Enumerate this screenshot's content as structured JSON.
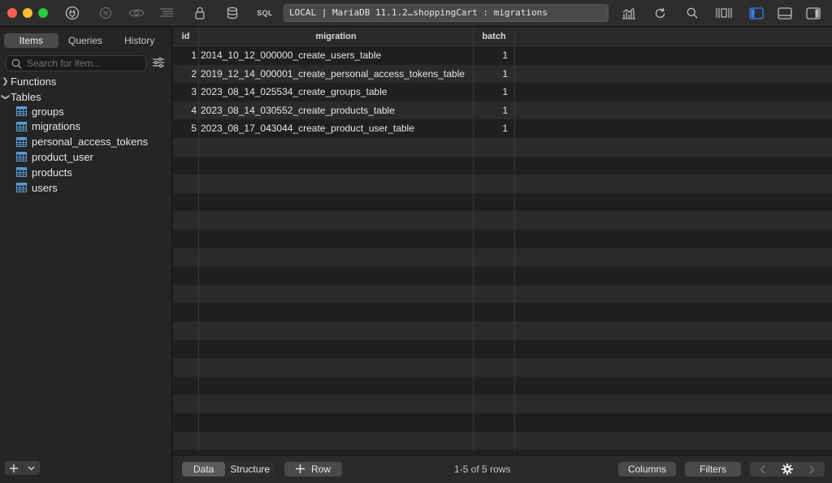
{
  "toolbar": {
    "sql_label": "SQL",
    "connection": "LOCAL | MariaDB 11.1.2…shoppingCart : migrations"
  },
  "sidebar": {
    "tabs": [
      {
        "label": "Items",
        "active": true
      },
      {
        "label": "Queries",
        "active": false
      },
      {
        "label": "History",
        "active": false
      }
    ],
    "search_placeholder": "Search for item...",
    "sections": {
      "functions": "Functions",
      "tables": "Tables"
    },
    "tables": [
      "groups",
      "migrations",
      "personal_access_tokens",
      "product_user",
      "products",
      "users"
    ]
  },
  "grid": {
    "columns": [
      "id",
      "migration",
      "batch"
    ],
    "rows": [
      {
        "id": "1",
        "migration": "2014_10_12_000000_create_users_table",
        "batch": "1"
      },
      {
        "id": "2",
        "migration": "2019_12_14_000001_create_personal_access_tokens_table",
        "batch": "1"
      },
      {
        "id": "3",
        "migration": "2023_08_14_025534_create_groups_table",
        "batch": "1"
      },
      {
        "id": "4",
        "migration": "2023_08_14_030552_create_products_table",
        "batch": "1"
      },
      {
        "id": "5",
        "migration": "2023_08_17_043044_create_product_user_table",
        "batch": "1"
      }
    ]
  },
  "footer": {
    "data_tab": "Data",
    "structure_tab": "Structure",
    "add_row": "Row",
    "row_count": "1-5 of 5 rows",
    "columns_button": "Columns",
    "filters_button": "Filters"
  },
  "colors": {
    "accent": "#3b82f6",
    "table_icon": "#5b9bd5"
  }
}
